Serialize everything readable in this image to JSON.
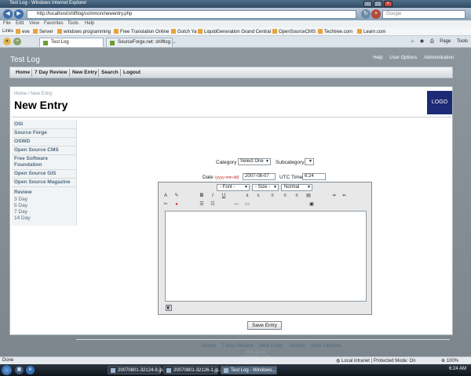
{
  "browser": {
    "window_title": "Test Log - Windows Internet Explorer",
    "url": "http://localhost/shiftlog/common/newentry.php",
    "search_placeholder": "Google",
    "menu": [
      "File",
      "Edit",
      "View",
      "Favorites",
      "Tools",
      "Help"
    ],
    "links_label": "Links",
    "links": [
      "eve",
      "Server",
      "windows programming",
      "Free Translation Online",
      "Gotch Ya",
      "LiquidGeneration Grand Central",
      "OpenSourceCMS",
      "Techtree.com",
      "Learn.com"
    ],
    "tabs": [
      "Test Log",
      "SourceForge.net: shiftlog ..."
    ],
    "toolbar": {
      "page_label": "Page",
      "tools_label": "Tools"
    }
  },
  "site": {
    "title": "Test Log",
    "top_links": [
      "Help",
      "User Options",
      "Administration"
    ],
    "nav": [
      "Home",
      "7 Day Review",
      "New Entry",
      "Search",
      "Logout"
    ],
    "breadcrumb": "Home / New Entry",
    "page_title": "New Entry",
    "logo": "LOGO"
  },
  "sidebar": {
    "items": [
      "OSI",
      "Source Forge",
      "OSWD",
      "Open Source CMS",
      "Free Software Foundation",
      "Open Source GIS",
      "Open Source Magazine"
    ],
    "review_heading": "Review",
    "review_items": [
      "3 Day",
      "5 Day",
      "7 Day",
      "14 Day"
    ]
  },
  "form": {
    "category_label": "Category",
    "category_value": "Select One",
    "subcategory_label": "Subcategory",
    "subcategory_value": "",
    "date_label": "Date",
    "date_format": "(yyyy-mm-dd)",
    "date_value": "2007-08-07",
    "utc_label": "UTC Time",
    "utc_value": "6:24",
    "editor": {
      "font": "- Font -",
      "size": "- Size -",
      "format": "Normal"
    },
    "save_label": "Save Entry"
  },
  "footer": {
    "links": [
      "Home",
      "7 Day Review",
      "New Entry",
      "Search",
      "User Options"
    ],
    "line1": "ShiftLog v0.1",
    "line2": "Copyright © 2007",
    "line3": "All Rights Reserved",
    "license_prefix": "Distributed under the",
    "license_link": "GNU General Public License"
  },
  "status": {
    "left": "Done",
    "zone": "Local intranet | Protected Mode: On",
    "zoom": "100%"
  },
  "taskbar": {
    "tasks": [
      "20070801-32124-9.jp...",
      "20070801-32126-1.jp...",
      "Test Log - Windows..."
    ],
    "clock": "6:24 AM"
  }
}
